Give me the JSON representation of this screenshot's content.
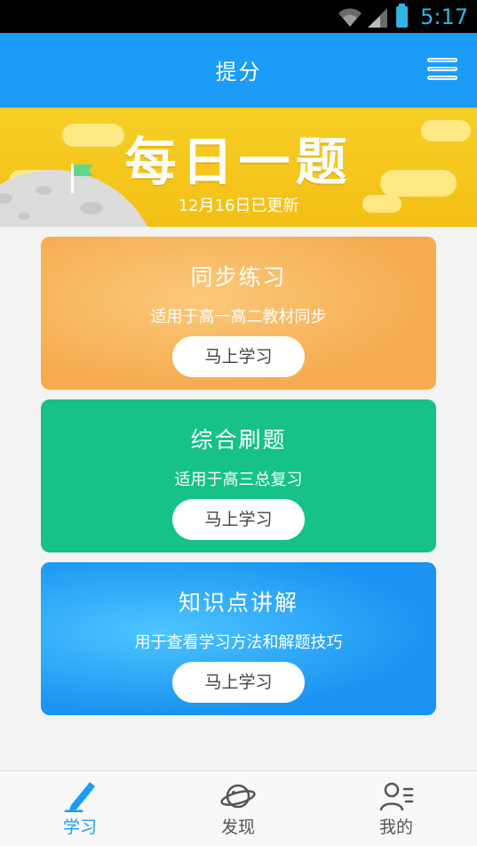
{
  "status_bar": {
    "time": "5:17"
  },
  "header": {
    "title": "提分"
  },
  "banner": {
    "title": "每日一题",
    "subtitle": "12月16日已更新"
  },
  "cards": [
    {
      "title": "同步练习",
      "description": "适用于高一高二教材同步",
      "button_label": "马上学习",
      "color": "#f6ab4f"
    },
    {
      "title": "综合刷题",
      "description": "适用于高三总复习",
      "button_label": "马上学习",
      "color": "#16c285"
    },
    {
      "title": "知识点讲解",
      "description": "用于查看学习方法和解题技巧",
      "button_label": "马上学习",
      "color": "#1a93f2"
    }
  ],
  "bottom_nav": [
    {
      "label": "学习",
      "icon": "pencil-icon",
      "active": true
    },
    {
      "label": "发现",
      "icon": "planet-icon",
      "active": false
    },
    {
      "label": "我的",
      "icon": "user-icon",
      "active": false
    }
  ],
  "colors": {
    "accent": "#1a9cf8",
    "banner": "#f4bf14",
    "inactive": "#555555"
  }
}
